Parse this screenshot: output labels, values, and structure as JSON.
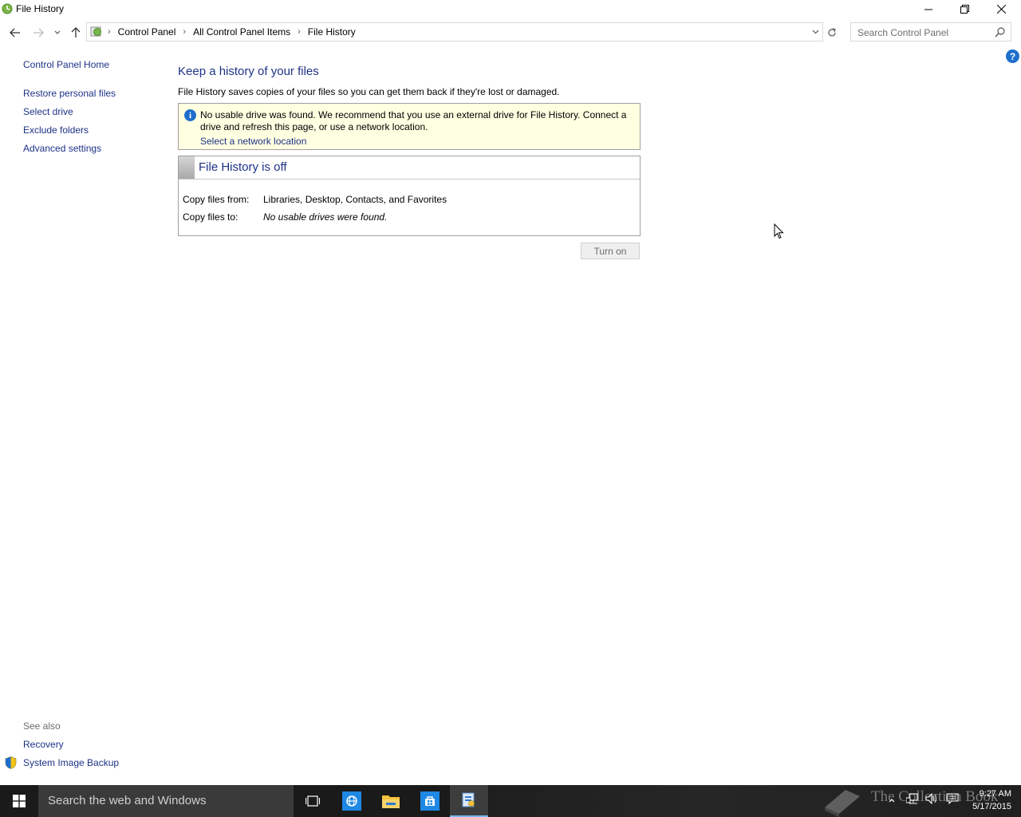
{
  "window": {
    "title": "File History"
  },
  "address": {
    "crumbs": [
      "Control Panel",
      "All Control Panel Items",
      "File History"
    ]
  },
  "search": {
    "placeholder": "Search Control Panel"
  },
  "help_label": "?",
  "left_nav": {
    "home": "Control Panel Home",
    "items": [
      "Restore personal files",
      "Select drive",
      "Exclude folders",
      "Advanced settings"
    ]
  },
  "see_also": {
    "heading": "See also",
    "links": [
      "Recovery",
      "System Image Backup"
    ]
  },
  "main": {
    "heading": "Keep a history of your files",
    "description": "File History saves copies of your files so you can get them back if they're lost or damaged.",
    "info": {
      "icon_glyph": "i",
      "text": "No usable drive was found. We recommend that you use an external drive for File History. Connect a drive and refresh this page, or use a network location.",
      "link": "Select a network location"
    },
    "status": {
      "title": "File History is off",
      "copy_from_label": "Copy files from:",
      "copy_from_value": "Libraries, Desktop, Contacts, and Favorites",
      "copy_to_label": "Copy files to:",
      "copy_to_value": "No usable drives were found."
    },
    "turn_on_label": "Turn on"
  },
  "taskbar": {
    "search_placeholder": "Search the web and Windows",
    "time": "9:27 AM",
    "date": "5/17/2015",
    "watermark": "The Collection Book"
  },
  "colors": {
    "link": "#1e3287",
    "info_background": "#ffffe1",
    "taskbar": "#1a1a1a",
    "accent": "#1e6fcd"
  }
}
